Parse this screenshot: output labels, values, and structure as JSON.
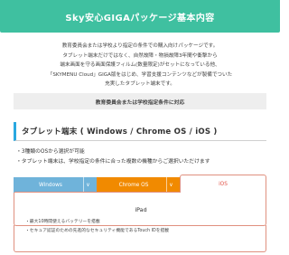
{
  "header": {
    "title": "Sky安心GIGAパッケージ基本内容"
  },
  "intro": {
    "lines": [
      "教育委員会または学校より指定の条件での購入向けパッケージです。",
      "タブレット端末だけではなく、自然故障・物損故障3年間や衝撃から",
      "端末画面を守る画面保護フィルム(数量限定)がセットになっている他、",
      "「SKYMENU Cloud」GIGA版をはじめ、学習支援コンテンツなどが製備でついた",
      "充実したタブレット端末です。"
    ]
  },
  "notice": {
    "text": "教育委員会または学校指定条件に対応"
  },
  "section": {
    "title": "タブレット端末 ( Windows / Chrome OS / iOS )"
  },
  "bullets": [
    "・3種類のOSから選択が可能",
    "・タブレット端末は、学校指定の条件に合った複数の機種からご選択いただけます"
  ],
  "tabs": {
    "windows": "Windows",
    "chrome": "Chrome OS",
    "ios": "iOS",
    "chevron": "∨"
  },
  "panel": {
    "title": "iPad",
    "bullets": [
      "・最大10時間使えるバッテリーを搭載",
      "・セキュア認証のための先進的なセキュリティ機能であるTouch IDを搭載"
    ]
  },
  "colors": {
    "header": "#3fc0a0",
    "windows_tab": "#6fb3da",
    "chrome_tab": "#f18a00",
    "ios_accent": "#e2554a",
    "section_accent": "#2aa8e0"
  }
}
